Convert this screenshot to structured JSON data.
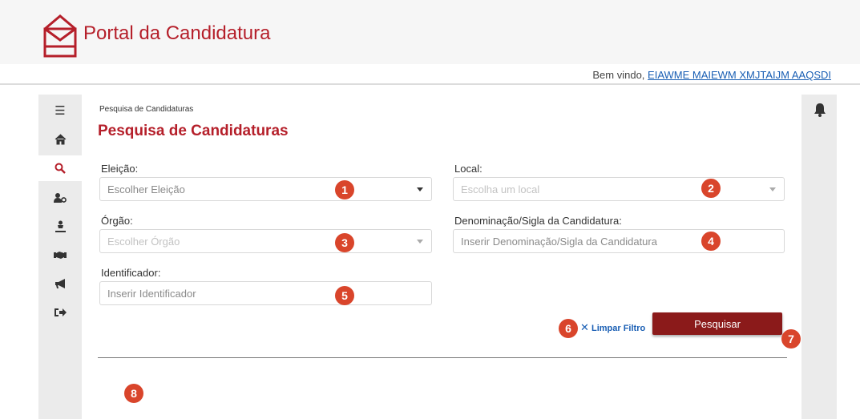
{
  "header": {
    "title": "Portal da Candidatura",
    "welcome_prefix": "Bem vindo, ",
    "user_name": "EIAWME MAIEWM XMJTAIJM AAQSDI"
  },
  "sidebar": {
    "items": [
      {
        "icon": "menu-icon",
        "glyph": "☰"
      },
      {
        "icon": "home-icon",
        "glyph": "⌂"
      },
      {
        "icon": "search-icon",
        "glyph": "⚲"
      },
      {
        "icon": "users-settings-icon",
        "glyph": "👥"
      },
      {
        "icon": "person-icon",
        "glyph": "⚓"
      },
      {
        "icon": "handshake-icon",
        "glyph": "🤝"
      },
      {
        "icon": "megaphone-icon",
        "glyph": "📢"
      },
      {
        "icon": "sign-out-icon",
        "glyph": "⇥"
      }
    ]
  },
  "breadcrumb": "Pesquisa de Candidaturas",
  "page_title": "Pesquisa de Candidaturas",
  "form": {
    "eleicao": {
      "label": "Eleição:",
      "placeholder": "Escolher Eleição"
    },
    "local": {
      "label": "Local:",
      "placeholder": "Escolha um local"
    },
    "orgao": {
      "label": "Órgão:",
      "placeholder": "Escolher Órgão"
    },
    "denominacao": {
      "label": "Denominação/Sigla da Candidatura:",
      "placeholder": "Inserir Denominação/Sigla da Candidatura"
    },
    "identificador": {
      "label": "Identificador:",
      "placeholder": "Inserir Identificador"
    }
  },
  "actions": {
    "clear_label": "Limpar Filtro",
    "search_label": "Pesquisar"
  },
  "badges": [
    "1",
    "2",
    "3",
    "4",
    "5",
    "6",
    "7",
    "8"
  ],
  "colors": {
    "brand": "#b51f2a",
    "button": "#8b1a1a",
    "badge": "#d9452b",
    "link": "#1a5fb4"
  }
}
